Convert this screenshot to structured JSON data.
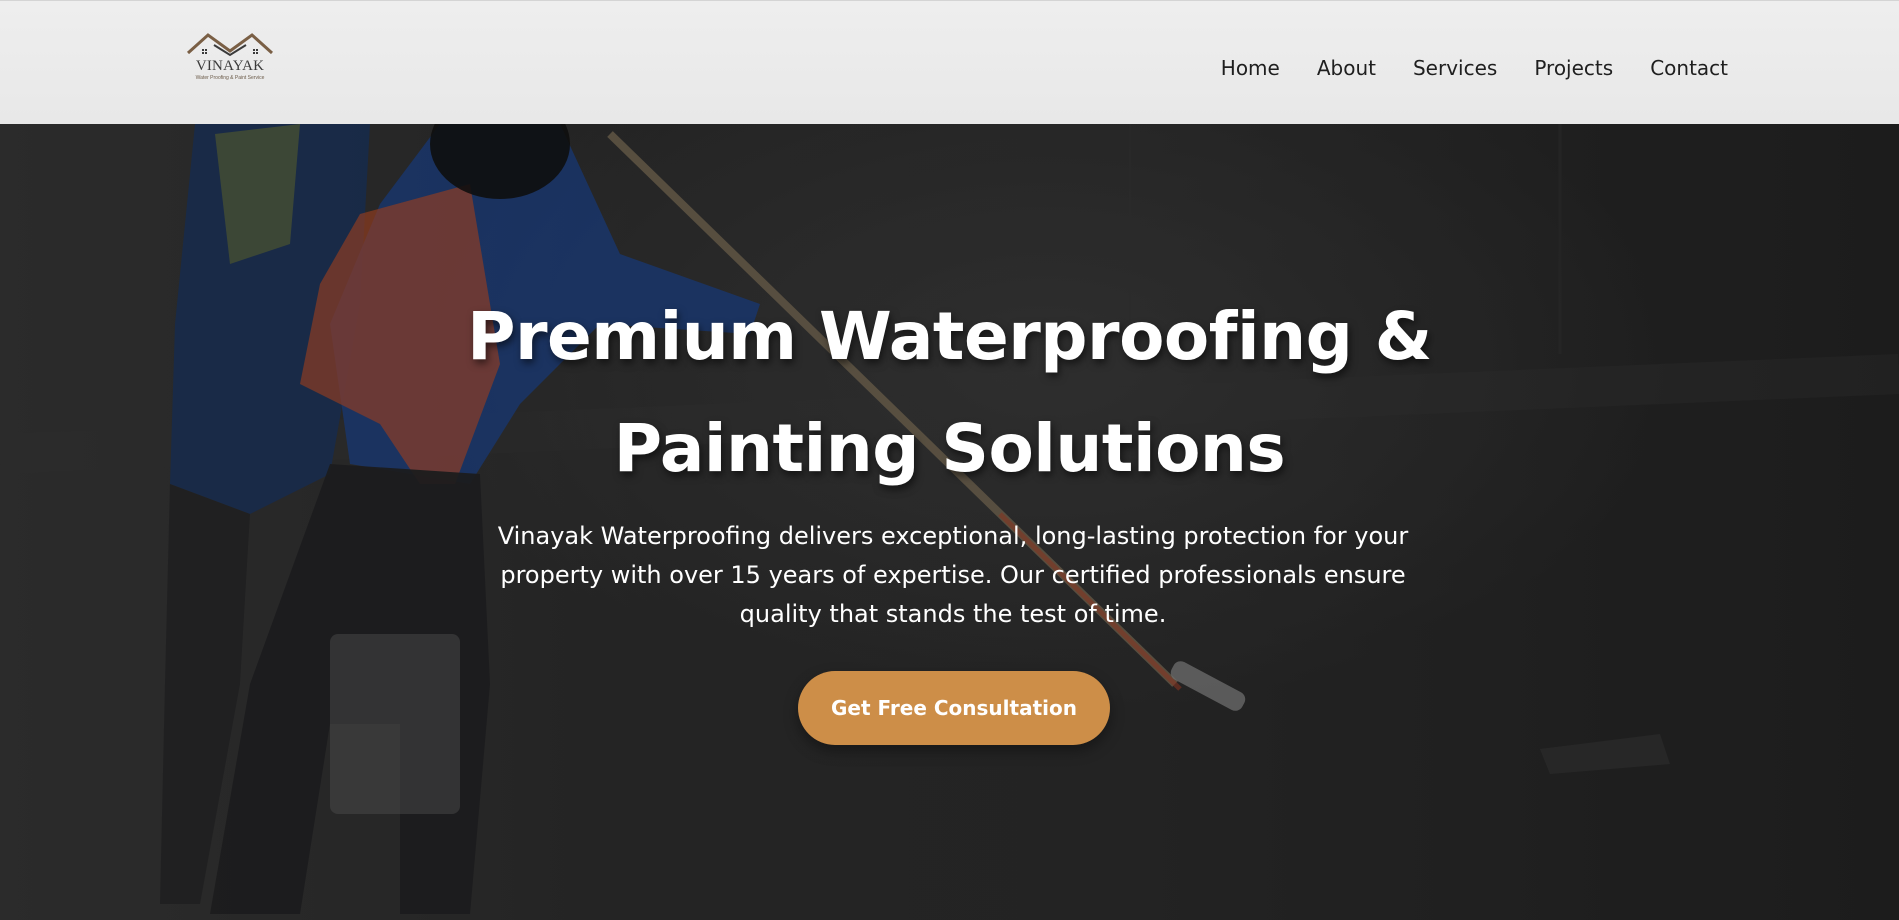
{
  "header": {
    "logo": {
      "name": "VINAYAK",
      "tagline": "Water Proofing & Paint Service"
    },
    "nav": [
      {
        "label": "Home"
      },
      {
        "label": "About"
      },
      {
        "label": "Services"
      },
      {
        "label": "Projects"
      },
      {
        "label": "Contact"
      }
    ]
  },
  "hero": {
    "title_line1": "Premium Waterproofing &",
    "title_line2": "Painting Solutions",
    "description": "Vinayak Waterproofing delivers exceptional, long-lasting protection for your property with over 15 years of expertise. Our certified professionals ensure quality that stands the test of time.",
    "cta_label": "Get Free Consultation"
  },
  "colors": {
    "accent": "#cd8e48",
    "header_bg": "#eaeaea",
    "hero_text": "#ffffff"
  }
}
